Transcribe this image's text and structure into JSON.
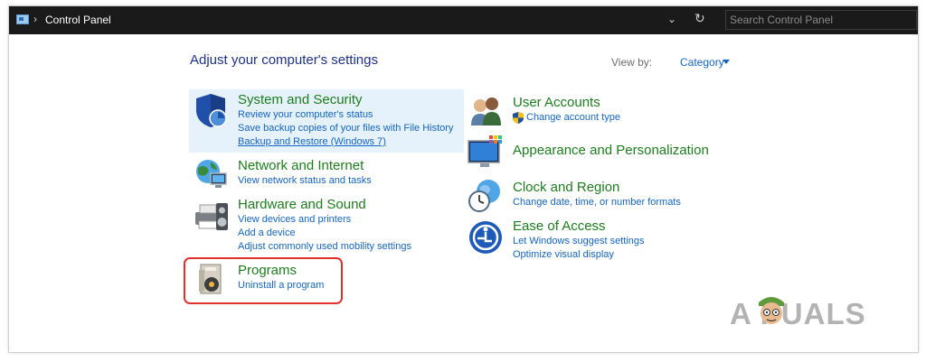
{
  "address_bar": {
    "breadcrumb_separator": "›",
    "current_location": "Control Panel",
    "dropdown_glyph": "⌄",
    "refresh_glyph": "↻",
    "search_placeholder": "Search Control Panel"
  },
  "header": {
    "heading": "Adjust your computer's settings",
    "view_by_label": "View by:",
    "view_by_value": "Category"
  },
  "categories_left": [
    {
      "title": "System and Security",
      "icon": "shield-icon",
      "links": [
        "Review your computer's status",
        "Save backup copies of your files with File History",
        "Backup and Restore (Windows 7)"
      ],
      "highlighted": true
    },
    {
      "title": "Network and Internet",
      "icon": "network-globe-icon",
      "links": [
        "View network status and tasks"
      ]
    },
    {
      "title": "Hardware and Sound",
      "icon": "printer-speaker-icon",
      "links": [
        "View devices and printers",
        "Add a device",
        "Adjust commonly used mobility settings"
      ]
    },
    {
      "title": "Programs",
      "icon": "programs-disc-icon",
      "links": [
        "Uninstall a program"
      ],
      "annotated": true
    }
  ],
  "categories_right": [
    {
      "title": "User Accounts",
      "icon": "user-accounts-icon",
      "links": [
        "Change account type"
      ],
      "link_icon": "uac-shield-icon"
    },
    {
      "title": "Appearance and Personalization",
      "icon": "monitor-palette-icon",
      "links": []
    },
    {
      "title": "Clock and Region",
      "icon": "clock-globe-icon",
      "links": [
        "Change date, time, or number formats"
      ]
    },
    {
      "title": "Ease of Access",
      "icon": "ease-of-access-icon",
      "links": [
        "Let Windows suggest settings",
        "Optimize visual display"
      ]
    }
  ],
  "watermark": {
    "text": "A  PUALS"
  },
  "colors": {
    "address_bar_bg": "#1a1a1a",
    "category_title": "#1e7d1e",
    "link": "#1565c0",
    "heading": "#1e3287",
    "highlight_bg": "#e5f1fb",
    "annotation_box": "#e0302e"
  }
}
